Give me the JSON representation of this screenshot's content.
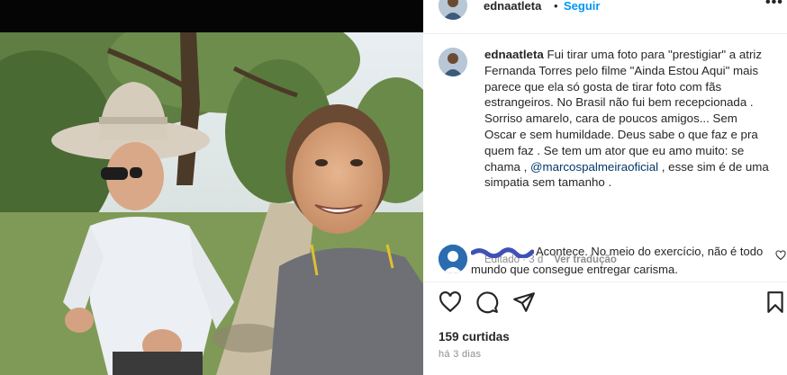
{
  "post": {
    "username": "ednaatleta",
    "follow_label": "Seguir",
    "header_separator": "•",
    "more_label": "•••"
  },
  "caption": {
    "username": "ednaatleta",
    "text_before_mention": "Fui tirar uma foto para \"prestigiar\" a atriz Fernanda Torres pelo filme \"Ainda Estou Aqui\" mais parece que ela só gosta de tirar foto com fãs estrangeiros. No Brasil não fui bem recepcionada . Sorriso amarelo, cara de poucos amigos... Sem Oscar e sem humildade. Deus sabe o que faz e pra quem faz . Se tem um ator que eu amo muito: se chama ,",
    "mention": "@marcospalmeiraoficial",
    "text_after_mention": ", esse sim é de uma simpatia sem tamanho .",
    "edited_label": "Editado · 3 d",
    "translate_label": "Ver tradução"
  },
  "comment": {
    "text": "Acontece. No meio do exercício, não é todo mundo que consegue entregar carisma."
  },
  "actions": {
    "likes_label": "159 curtidas",
    "time_label": "há 3 dias"
  },
  "icons": {
    "like": "heart-icon",
    "comment": "comment-icon",
    "share": "paper-plane-icon",
    "save": "bookmark-icon",
    "more": "more-icon"
  },
  "colors": {
    "link_blue": "#0095f6",
    "mention_blue": "#00376b",
    "muted_text": "#8e8e8e"
  }
}
